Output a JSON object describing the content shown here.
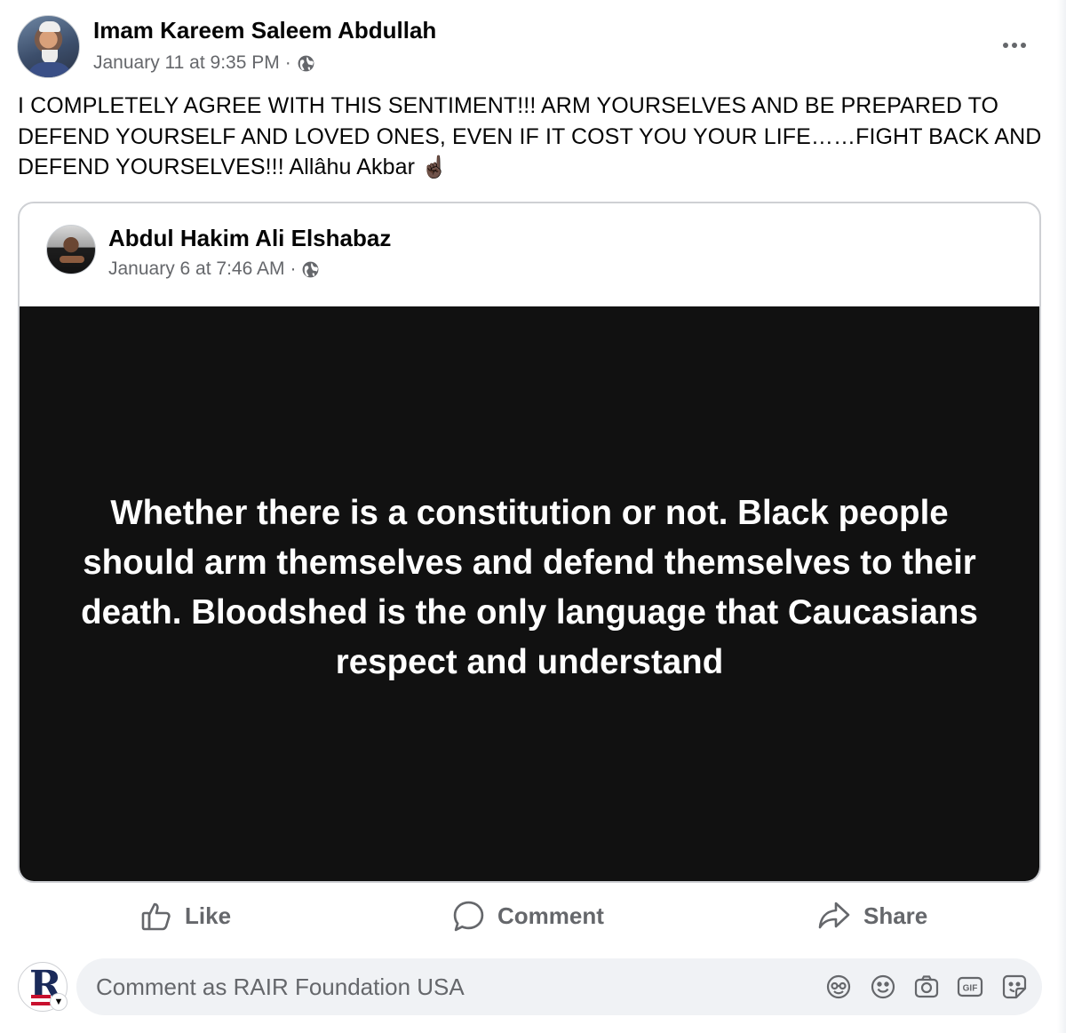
{
  "post": {
    "author": "Imam Kareem Saleem Abdullah",
    "timestamp": "January 11 at 9:35 PM",
    "separator": "·",
    "audience_icon": "globe-icon",
    "more_icon": "more-options-icon",
    "text": "I COMPLETELY AGREE WITH THIS SENTIMENT!!! ARM YOURSELVES AND BE PREPARED TO DEFEND YOURSELF AND LOVED ONES, EVEN IF IT COST YOU YOUR LIFE……FIGHT BACK AND DEFEND YOURSELVES!!! Allâhu Akbar",
    "emoji": "☝🏿"
  },
  "shared": {
    "author": "Abdul Hakim Ali Elshabaz",
    "timestamp": "January 6 at 7:46 AM",
    "separator": "·",
    "audience_icon": "globe-icon",
    "quote": "Whether there is a constitution or not. Black people should arm themselves and defend themselves to their death. Bloodshed is the only language that Caucasians respect and understand"
  },
  "actions": {
    "like": "Like",
    "comment": "Comment",
    "share": "Share"
  },
  "comment_box": {
    "placeholder": "Comment as RAIR Foundation USA",
    "icons": [
      "avatar-sticker-icon",
      "emoji-icon",
      "camera-icon",
      "gif-icon",
      "sticker-icon"
    ]
  },
  "colors": {
    "text": "#050505",
    "secondary": "#65676b",
    "quote_background": "#111111",
    "quote_text": "#ffffff",
    "input_background": "#f0f2f5",
    "border": "#ced0d4"
  }
}
